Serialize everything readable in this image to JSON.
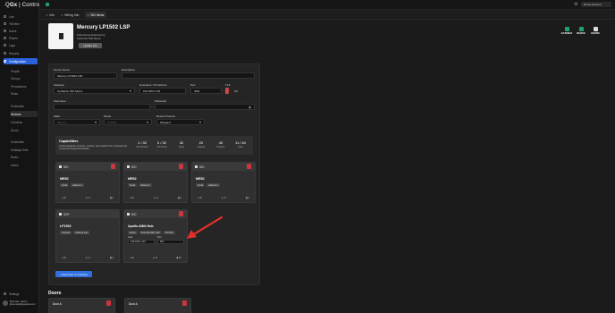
{
  "app": {
    "logo_mark": "Q",
    "logo_bold": "Gx",
    "logo_text": " | Control"
  },
  "sidebar": {
    "items": [
      {
        "label": "Live"
      },
      {
        "label": "Timeline"
      },
      {
        "label": "Users"
      },
      {
        "label": "Places"
      },
      {
        "label": "Logs"
      },
      {
        "label": "Reports"
      },
      {
        "label": "Configuration"
      },
      {
        "label": "People"
      },
      {
        "label": "Groups"
      },
      {
        "label": "Permissions"
      },
      {
        "label": "Rules"
      },
      {
        "label": "Schedules"
      },
      {
        "label": "Devices"
      },
      {
        "label": "Cameras"
      },
      {
        "label": "Doors"
      },
      {
        "label": "Schedules"
      },
      {
        "label": "Holidays Sets"
      },
      {
        "label": "Roles"
      },
      {
        "label": "Views"
      },
      {
        "label": "Settings"
      }
    ],
    "user": {
      "name": "Brennan, Jason",
      "email": "jbrennan@quanta.com"
    }
  },
  "topbar": {
    "account": "Demo Account"
  },
  "tabs": [
    {
      "label": "Info"
    },
    {
      "label": "Wiring Info"
    },
    {
      "label": "SIO Items"
    }
  ],
  "device": {
    "title": "Mercury LP1502 LSP",
    "line1": "Powerhouse Engineering",
    "line2": "CpControl 500 Series",
    "update_button": "Update info",
    "actions": [
      {
        "label": "GATEWAY",
        "color": "#22a06b"
      },
      {
        "label": "DEVICE",
        "color": "#22a06b"
      },
      {
        "label": "DOORS",
        "color": "#dddddd"
      }
    ]
  },
  "form": {
    "device_name_label": "Device Name",
    "device_name_value": "Mercury LP1502 LSP",
    "description_label": "Description",
    "description_value": "",
    "gateway_label": "Gateway",
    "gateway_value": "CpStation 500 Series",
    "hostname_label": "Hostname / IP Address",
    "hostname_value": "192.168.0.142",
    "port_label": "Port",
    "port_value": "3001",
    "tls_label": "TLS",
    "tls_state": "Off",
    "username_label": "Username",
    "password_label": "Password",
    "make_label": "Make",
    "make_value": "Mercury",
    "model_label": "Model",
    "model_value": "LP1502",
    "protocol_label": "Device Protocol",
    "protocol_value": "Wiegand"
  },
  "capabilities": {
    "title": "Capabilities",
    "description": "A full breakdown of inputs, outputs, and readers from onboard and connected Supported boards.",
    "items": [
      {
        "value": "1 / 32",
        "label": "SIO Network"
      },
      {
        "value": "0 / 32",
        "label": "SIO Serial"
      },
      {
        "value": "32",
        "label": "Inputs"
      },
      {
        "value": "22",
        "label": "Outputs"
      },
      {
        "value": "40",
        "label": "Readers"
      },
      {
        "value": "11 / 64",
        "label": "Used"
      }
    ]
  },
  "modules": [
    {
      "type": "SIO",
      "name": "MR52",
      "tags": [
        "Serial",
        "Address 1"
      ],
      "stats": [
        "8",
        "4",
        "2"
      ]
    },
    {
      "type": "SIO",
      "name": "MR52",
      "tags": [
        "Serial",
        "Address 2"
      ],
      "stats": [
        "8",
        "6",
        "2"
      ]
    },
    {
      "type": "SIO",
      "name": "MR52",
      "tags": [
        "Serial",
        "Address 3"
      ],
      "stats": [
        "8",
        "6",
        "2"
      ]
    },
    {
      "type": "SCP",
      "name": "LP1502",
      "tags": [
        "Onboard",
        "Address auto"
      ],
      "stats": [
        "8",
        "4",
        "2"
      ]
    },
    {
      "type": "SIO",
      "name": "Apollo AIM4 Hub",
      "tags": [
        "Apollo",
        "Host 192.168.1.120",
        "Port 501"
      ],
      "ip_label": "Host",
      "ip_value": "192.168.1.120",
      "port_label": "Port",
      "port_value": "501",
      "stats": [
        "8",
        "8",
        "32"
      ]
    }
  ],
  "add_button": "+ Add Input or Interface",
  "doors": {
    "title": "Doors",
    "items": [
      {
        "label": "Door A"
      },
      {
        "label": "Door A"
      }
    ]
  }
}
